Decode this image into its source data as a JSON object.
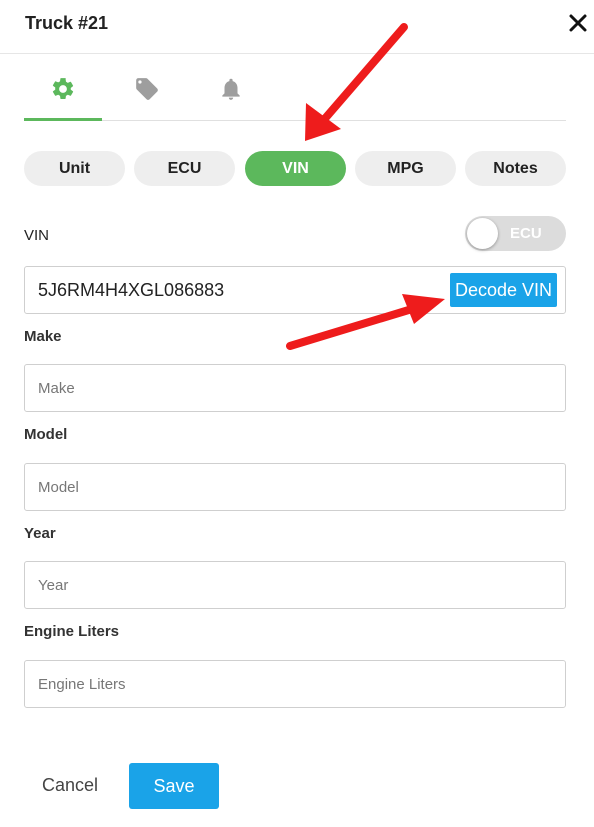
{
  "header": {
    "title": "Truck #21"
  },
  "icon_tabs": [
    {
      "name": "settings",
      "icon": "gear-icon",
      "active": true
    },
    {
      "name": "tags",
      "icon": "tag-icon",
      "active": false
    },
    {
      "name": "alerts",
      "icon": "bell-icon",
      "active": false
    }
  ],
  "pills": [
    {
      "label": "Unit",
      "active": false
    },
    {
      "label": "ECU",
      "active": false
    },
    {
      "label": "VIN",
      "active": true
    },
    {
      "label": "MPG",
      "active": false
    },
    {
      "label": "Notes",
      "active": false
    }
  ],
  "vin": {
    "label": "VIN",
    "value": "5J6RM4H4XGL086883",
    "toggle_label": "ECU",
    "toggle_on": false,
    "decode_label": "Decode VIN"
  },
  "fields": {
    "make": {
      "label": "Make",
      "placeholder": "Make",
      "value": ""
    },
    "model": {
      "label": "Model",
      "placeholder": "Model",
      "value": ""
    },
    "year": {
      "label": "Year",
      "placeholder": "Year",
      "value": ""
    },
    "engine": {
      "label": "Engine Liters",
      "placeholder": "Engine Liters",
      "value": ""
    }
  },
  "footer": {
    "cancel_label": "Cancel",
    "save_label": "Save"
  },
  "colors": {
    "active_green": "#5cb85c",
    "primary_blue": "#1aa3e8",
    "annotation_red": "#ee1c1c",
    "pill_bg": "#eeeeee",
    "toggle_off_bg": "#dcdcdc",
    "inactive_icon": "#9e9e9e"
  }
}
